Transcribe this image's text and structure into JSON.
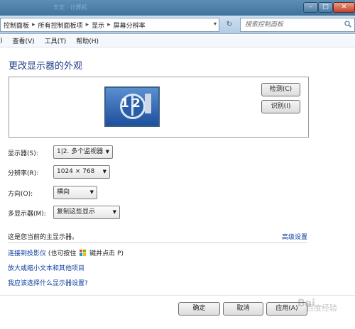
{
  "window": {
    "ghost_title": "辛文 · 计算机",
    "minimize_glyph": "–",
    "maximize_glyph": "□",
    "close_glyph": "✕"
  },
  "address_bar": {
    "breadcrumbs": [
      "控制面板",
      "所有控制面板项",
      "显示",
      "屏幕分辨率"
    ],
    "separator": "▸",
    "dropdown_glyph": "▾",
    "refresh_glyph": "↻",
    "search_placeholder": "搜索控制面板"
  },
  "menu": {
    "items": [
      "文件(F)",
      "查看(V)",
      "工具(T)",
      "帮助(H)"
    ],
    "visible_items": [
      ")",
      "查看(V)",
      "工具(T)",
      "帮助(H)"
    ]
  },
  "page": {
    "title": "更改显示器的外观",
    "monitor_numbers": [
      "1",
      "2"
    ],
    "detect_label": "检测(C)",
    "identify_label": "识别(I)"
  },
  "settings": {
    "display_label": "显示器(S):",
    "display_value": "1|2. 多个监视器",
    "resolution_label": "分辨率(R):",
    "resolution_value": "1024 × 768",
    "orientation_label": "方向(O):",
    "orientation_value": "横向",
    "multi_display_label": "多显示器(M):",
    "multi_display_value": "复制这些显示"
  },
  "notes": {
    "primary_monitor": "这是您当前的主显示器。",
    "advanced_settings": "高级设置"
  },
  "links": {
    "projector": "连接到投影仪",
    "projector_hint_before": "(也可按住",
    "projector_hint_after": "键并点击 P)",
    "text_size": "放大或缩小文本和其他项目",
    "which_settings": "我应该选择什么显示器设置?"
  },
  "footer": {
    "ok_label": "确定",
    "cancel_label": "取消",
    "apply_label": "应用(A)"
  },
  "watermark": {
    "text_a": "Bai",
    "text_b": "百度经验"
  },
  "colors": {
    "title_blue": "#1f3c88",
    "link_blue": "#0a3d9e",
    "titlebar": "#4a7eaa"
  }
}
